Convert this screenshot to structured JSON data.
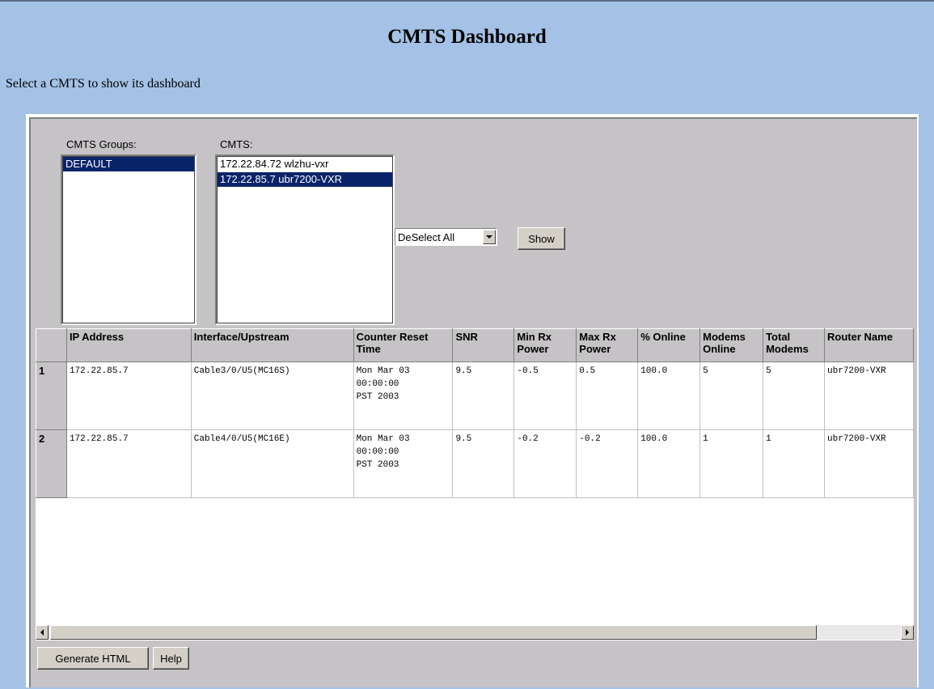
{
  "page": {
    "title": "CMTS Dashboard",
    "subtitle": "Select a CMTS to show its dashboard"
  },
  "filters": {
    "groups_label": "CMTS Groups:",
    "groups": [
      {
        "label": "DEFAULT",
        "selected": true
      }
    ],
    "cmts_label": "CMTS:",
    "cmts": [
      {
        "label": "172.22.84.72 wlzhu-vxr",
        "selected": false
      },
      {
        "label": "172.22.85.7 ubr7200-VXR",
        "selected": true
      }
    ],
    "select_value": "DeSelect All",
    "show_button": "Show"
  },
  "table": {
    "columns": [
      "IP Address",
      "Interface/Upstream",
      "Counter Reset Time",
      "SNR",
      "Min Rx Power",
      "Max Rx Power",
      "% Online",
      "Modems Online",
      "Total Modems",
      "Router Name"
    ],
    "rows": [
      {
        "num": "1",
        "ip": "172.22.85.7",
        "iface": "Cable3/0/U5(MC16S)",
        "reset_l1": "Mon Mar 03",
        "reset_l2": "00:00:00",
        "reset_l3": "PST 2003",
        "snr": "9.5",
        "min_rx": "-0.5",
        "max_rx": "0.5",
        "pct_online": "100.0",
        "modems_online": "5",
        "total_modems": "5",
        "router": "ubr7200-VXR"
      },
      {
        "num": "2",
        "ip": "172.22.85.7",
        "iface": "Cable4/0/U5(MC16E)",
        "reset_l1": "Mon Mar 03",
        "reset_l2": "00:00:00",
        "reset_l3": "PST 2003",
        "snr": "9.5",
        "min_rx": "-0.2",
        "max_rx": "-0.2",
        "pct_online": "100.0",
        "modems_online": "1",
        "total_modems": "1",
        "router": "ubr7200-VXR"
      }
    ]
  },
  "footer": {
    "generate_button": "Generate HTML",
    "help_button": "Help"
  }
}
